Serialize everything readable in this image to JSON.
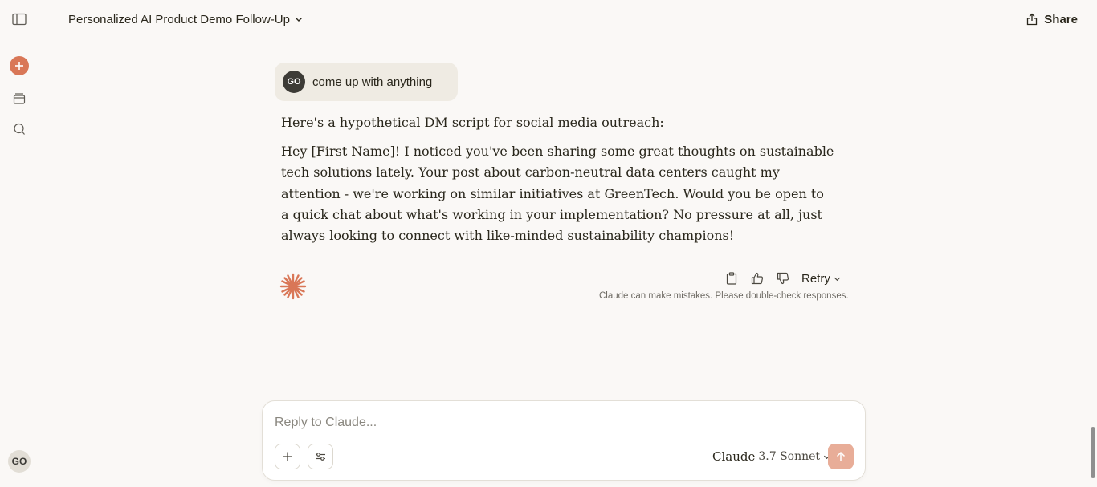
{
  "header": {
    "title": "Personalized AI Product Demo Follow-Up",
    "share_label": "Share"
  },
  "sidebar": {
    "user_initials": "GO"
  },
  "messages": {
    "user": {
      "initials": "GO",
      "text": "come up with anything"
    },
    "assistant": {
      "intro": "Here's a hypothetical DM script for social media outreach:",
      "body": "Hey [First Name]! I noticed you've been sharing some great thoughts on sustainable tech solutions lately. Your post about carbon-neutral data centers caught my attention - we're working on similar initiatives at GreenTech. Would you be open to a quick chat about what's working in your implementation? No pressure at all, just always looking to connect with like-minded sustainability champions!"
    },
    "actions": {
      "retry_label": "Retry"
    },
    "disclaimer": "Claude can make mistakes. Please double-check responses."
  },
  "composer": {
    "placeholder": "Reply to Claude...",
    "model_name": "Claude",
    "model_version": "3.7 Sonnet"
  },
  "colors": {
    "accent": "#d97757",
    "send_disabled": "#e8ad98",
    "background": "#faf8f6",
    "user_bubble": "#efebe3"
  }
}
